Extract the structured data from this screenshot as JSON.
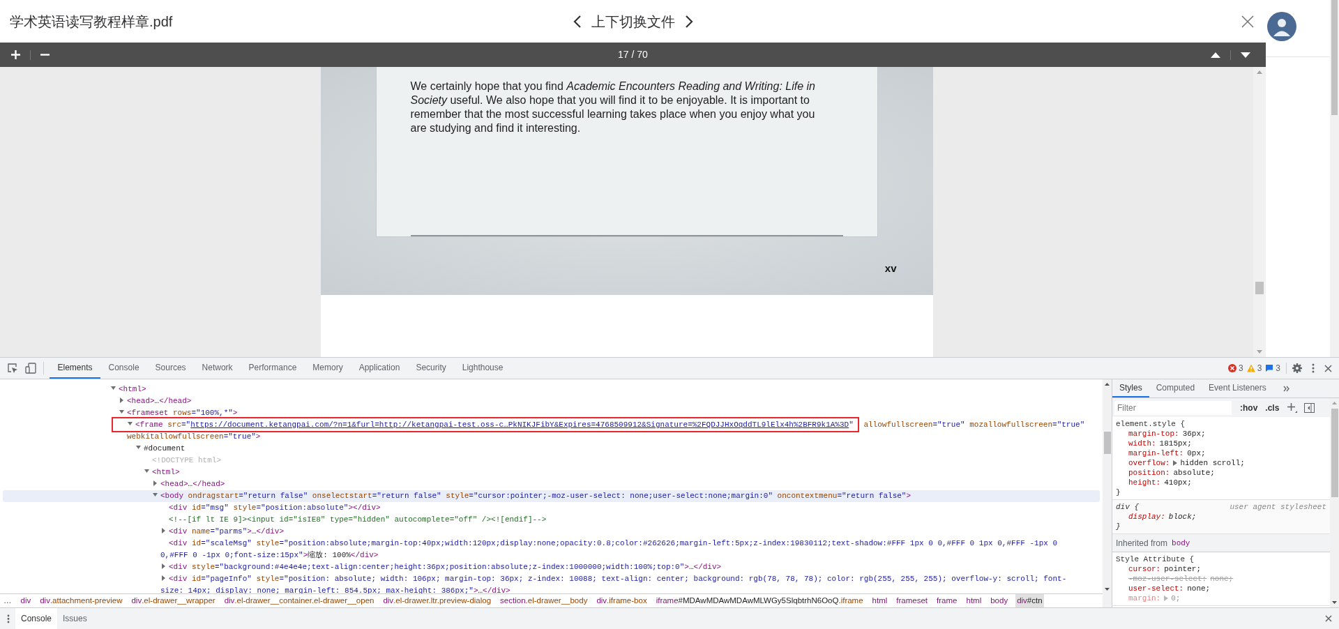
{
  "viewer": {
    "file_name": "学术英语读写教程样章.pdf",
    "switch_label": "上下切换文件",
    "page_indicator": "17 / 70"
  },
  "pdf_page": {
    "paragraph": "We certainly hope that you find *Academic Encounters Reading and Writing: Life in Society* useful. We also hope that you will find it to be enjoyable. It is important to remember that the most successful learning takes place when you enjoy what you are studying and find it interesting.",
    "folio": "xv"
  },
  "devtools": {
    "tabs": [
      {
        "label": "Elements",
        "selected": true
      },
      {
        "label": "Console",
        "selected": false
      },
      {
        "label": "Sources",
        "selected": false
      },
      {
        "label": "Network",
        "selected": false
      },
      {
        "label": "Performance",
        "selected": false
      },
      {
        "label": "Memory",
        "selected": false
      },
      {
        "label": "Application",
        "selected": false
      },
      {
        "label": "Security",
        "selected": false
      },
      {
        "label": "Lighthouse",
        "selected": false
      }
    ],
    "counters": [
      {
        "kind": "error",
        "count": "3"
      },
      {
        "kind": "warning",
        "count": "3"
      },
      {
        "kind": "info",
        "count": "3"
      }
    ],
    "dom_tree": [
      {
        "expanded": true,
        "selected": false,
        "parts": [
          {
            "kind": "tag",
            "text": "<html>"
          }
        ],
        "children": [
          {
            "expanded": false,
            "selected": false,
            "parts": [
              {
                "kind": "tag",
                "text": "<head>"
              },
              {
                "kind": "plain",
                "text": "…"
              },
              {
                "kind": "tag",
                "text": "</head>"
              }
            ]
          },
          {
            "expanded": true,
            "selected": false,
            "parts": [
              {
                "kind": "tag",
                "text": "<frameset"
              },
              {
                "kind": "attr",
                "text": " rows"
              },
              {
                "kind": "value",
                "text": "=\"100%,*\""
              },
              {
                "kind": "tag",
                "text": ">"
              }
            ],
            "children": [
              {
                "expanded": true,
                "selected": false,
                "highlight_parts": [
                  {
                    "kind": "tag",
                    "text": "<frame"
                  },
                  {
                    "kind": "attr",
                    "text": " src"
                  },
                  {
                    "kind": "value",
                    "text": "=\""
                  },
                  {
                    "kind": "link",
                    "text": "https://document.ketangpai.com/?n=1&furl=http://ketangpai-test.oss-c…PkNIKJFibY&Expires=4768509912&Signature=%2FQDJJHxOqddTL9lElx4h%2BFR9k1A%3D"
                  },
                  {
                    "kind": "value",
                    "text": "\""
                  }
                ],
                "parts": [
                  {
                    "kind": "attr",
                    "text": " allowfullscreen"
                  },
                  {
                    "kind": "value",
                    "text": "=\"true\""
                  },
                  {
                    "kind": "attr",
                    "text": " mozallowfullscreen"
                  },
                  {
                    "kind": "value",
                    "text": "=\"true\""
                  },
                  {
                    "kind": "attr",
                    "text": " webkitallowfullscreen"
                  },
                  {
                    "kind": "value",
                    "text": "=\"true\""
                  },
                  {
                    "kind": "tag",
                    "text": ">"
                  }
                ],
                "children": [
                  {
                    "expanded": true,
                    "selected": false,
                    "parts": [
                      {
                        "kind": "plain",
                        "text": "#document"
                      }
                    ],
                    "children": [
                      {
                        "selected": false,
                        "parts": [
                          {
                            "kind": "doctype",
                            "text": "<!DOCTYPE html>"
                          }
                        ]
                      },
                      {
                        "expanded": true,
                        "selected": false,
                        "parts": [
                          {
                            "kind": "tag",
                            "text": "<html>"
                          }
                        ],
                        "children": [
                          {
                            "expanded": false,
                            "selected": false,
                            "parts": [
                              {
                                "kind": "tag",
                                "text": "<head>"
                              },
                              {
                                "kind": "plain",
                                "text": "…"
                              },
                              {
                                "kind": "tag",
                                "text": "</head>"
                              }
                            ]
                          },
                          {
                            "expanded": true,
                            "selected": true,
                            "parts": [
                              {
                                "kind": "tag",
                                "text": "<body"
                              },
                              {
                                "kind": "attr",
                                "text": " ondragstart"
                              },
                              {
                                "kind": "value",
                                "text": "=\"return false\""
                              },
                              {
                                "kind": "attr",
                                "text": " onselectstart"
                              },
                              {
                                "kind": "value",
                                "text": "=\"return false\""
                              },
                              {
                                "kind": "attr",
                                "text": " style"
                              },
                              {
                                "kind": "value",
                                "text": "=\"cursor:pointer;-moz-user-select: none;user-select:none;margin:0\""
                              },
                              {
                                "kind": "attr",
                                "text": " oncontextmenu"
                              },
                              {
                                "kind": "value",
                                "text": "=\"return false\""
                              },
                              {
                                "kind": "tag",
                                "text": ">"
                              }
                            ],
                            "children": [
                              {
                                "selected": false,
                                "parts": [
                                  {
                                    "kind": "tag",
                                    "text": "<div"
                                  },
                                  {
                                    "kind": "attr",
                                    "text": " id"
                                  },
                                  {
                                    "kind": "value",
                                    "text": "=\"msg\""
                                  },
                                  {
                                    "kind": "attr",
                                    "text": " style"
                                  },
                                  {
                                    "kind": "value",
                                    "text": "=\"position:absolute\""
                                  },
                                  {
                                    "kind": "tag",
                                    "text": "></div>"
                                  }
                                ]
                              },
                              {
                                "selected": false,
                                "parts": [
                                  {
                                    "kind": "comment",
                                    "text": "<!--[if lt IE 9]><input id=\"isIE8\" type=\"hidden\" autocomplete=\"off\" /><![endif]-->"
                                  }
                                ]
                              },
                              {
                                "expanded": false,
                                "selected": false,
                                "parts": [
                                  {
                                    "kind": "tag",
                                    "text": "<div"
                                  },
                                  {
                                    "kind": "attr",
                                    "text": " name"
                                  },
                                  {
                                    "kind": "value",
                                    "text": "=\"parms\""
                                  },
                                  {
                                    "kind": "tag",
                                    "text": ">"
                                  },
                                  {
                                    "kind": "plain",
                                    "text": "…"
                                  },
                                  {
                                    "kind": "tag",
                                    "text": "</div>"
                                  }
                                ]
                              },
                              {
                                "selected": false,
                                "parts": [
                                  {
                                    "kind": "tag",
                                    "text": "<div"
                                  },
                                  {
                                    "kind": "attr",
                                    "text": " id"
                                  },
                                  {
                                    "kind": "value",
                                    "text": "=\"scaleMsg\""
                                  },
                                  {
                                    "kind": "attr",
                                    "text": " style"
                                  },
                                  {
                                    "kind": "value",
                                    "text": "=\"position:absolute;margin-top:40px;width:120px;display:none;opacity:0.8;color:#262626;margin-left:5px;z-index:19830112;text-shadow:#FFF 1px 0 0,#FFF 0 1px 0,#FFF -1px 0 0,#FFF 0 -1px 0;font-size:15px\""
                                  },
                                  {
                                    "kind": "tag",
                                    "text": ">"
                                  },
                                  {
                                    "kind": "plain",
                                    "text": "缩放: 100%"
                                  },
                                  {
                                    "kind": "tag",
                                    "text": "</div>"
                                  }
                                ]
                              },
                              {
                                "expanded": false,
                                "selected": false,
                                "parts": [
                                  {
                                    "kind": "tag",
                                    "text": "<div"
                                  },
                                  {
                                    "kind": "attr",
                                    "text": " style"
                                  },
                                  {
                                    "kind": "value",
                                    "text": "=\"background:#4e4e4e;text-align:center;height:36px;position:absolute;z-index:1000000;width:100%;top:0\""
                                  },
                                  {
                                    "kind": "tag",
                                    "text": ">"
                                  },
                                  {
                                    "kind": "plain",
                                    "text": "…"
                                  },
                                  {
                                    "kind": "tag",
                                    "text": "</div>"
                                  }
                                ]
                              },
                              {
                                "expanded": false,
                                "selected": false,
                                "parts": [
                                  {
                                    "kind": "tag",
                                    "text": "<div"
                                  },
                                  {
                                    "kind": "attr",
                                    "text": " id"
                                  },
                                  {
                                    "kind": "value",
                                    "text": "=\"pageInfo\""
                                  },
                                  {
                                    "kind": "attr",
                                    "text": " style"
                                  },
                                  {
                                    "kind": "value",
                                    "text": "=\"position: absolute; width: 106px; margin-top: 36px; z-index: 10088; text-align: center; background: rgb(78, 78, 78); color: rgb(255, 255, 255); overflow-y: scroll; font-size: 14px; display: none; margin-left: 854.5px; max-height: 386px;\""
                                  },
                                  {
                                    "kind": "tag",
                                    "text": ">"
                                  },
                                  {
                                    "kind": "plain",
                                    "text": "…"
                                  },
                                  {
                                    "kind": "tag",
                                    "text": "</div>"
                                  }
                                ]
                              }
                            ]
                          }
                        ]
                      }
                    ]
                  }
                ]
              }
            ]
          }
        ]
      }
    ],
    "breadcrumb_overflow": "…",
    "breadcrumbs": [
      {
        "tag": "div",
        "selected": false
      },
      {
        "tag": "div",
        "classes": ".attachment-preview",
        "selected": false
      },
      {
        "tag": "div",
        "classes": ".el-drawer__wrapper",
        "selected": false
      },
      {
        "tag": "div",
        "classes": ".el-drawer__container.el-drawer__open",
        "selected": false
      },
      {
        "tag": "div",
        "classes": ".el-drawer.ltr.preview-dialog",
        "selected": false
      },
      {
        "tag": "section",
        "classes": ".el-drawer__body",
        "selected": false
      },
      {
        "tag": "div",
        "classes": ".iframe-box",
        "selected": false
      },
      {
        "tag": "iframe",
        "id": "#MDAwMDAwMDAwMLWGy5SlqbtrhN6OoQ",
        "classes": ".iframe",
        "selected": false
      },
      {
        "tag": "html",
        "selected": false
      },
      {
        "tag": "frameset",
        "selected": false
      },
      {
        "tag": "frame",
        "selected": false
      },
      {
        "tag": "html",
        "selected": false
      },
      {
        "tag": "body",
        "selected": false
      },
      {
        "tag": "div",
        "id": "#ctn",
        "selected": true
      }
    ],
    "styles_panel": {
      "tabs": [
        {
          "label": "Styles",
          "selected": true
        },
        {
          "label": "Computed",
          "selected": false
        },
        {
          "label": "Event Listeners",
          "selected": false
        }
      ],
      "filter": {
        "placeholder": "Filter"
      },
      "toggles": [
        ":hov",
        ".cls"
      ],
      "rules": [
        {
          "kind": "rule",
          "selector": "element.style {",
          "close": "}",
          "properties": [
            {
              "name": "margin-top:",
              "value": "36px;",
              "overridden": false,
              "inactive": false,
              "expandable": false
            },
            {
              "name": "width:",
              "value": "1815px;",
              "overridden": false,
              "inactive": false,
              "expandable": false
            },
            {
              "name": "margin-left:",
              "value": "0px;",
              "overridden": false,
              "inactive": false,
              "expandable": false
            },
            {
              "name": "overflow:",
              "value": "hidden scroll;",
              "overridden": false,
              "inactive": false,
              "expandable": true
            },
            {
              "name": "position:",
              "value": "absolute;",
              "overridden": false,
              "inactive": false,
              "expandable": false
            },
            {
              "name": "height:",
              "value": "410px;",
              "overridden": false,
              "inactive": false,
              "expandable": false
            }
          ]
        },
        {
          "kind": "rule",
          "selector": "div {",
          "origin": "user agent stylesheet",
          "close": "}",
          "properties": [
            {
              "name": "display:",
              "value": "block;",
              "overridden": false,
              "inactive": false,
              "expandable": false
            }
          ]
        },
        {
          "kind": "inherited",
          "label": "Inherited from",
          "source": "body"
        },
        {
          "kind": "rule",
          "selector": "Style Attribute {",
          "properties": [
            {
              "name": "cursor:",
              "value": "pointer;",
              "overridden": false,
              "inactive": false,
              "expandable": false
            },
            {
              "name": "-moz-user-select:",
              "value": "none;",
              "overridden": true,
              "inactive": false,
              "expandable": false
            },
            {
              "name": "user-select:",
              "value": "none;",
              "overridden": false,
              "inactive": false,
              "expandable": false
            },
            {
              "name": "margin:",
              "value": "0;",
              "overridden": false,
              "inactive": true,
              "expandable": true
            }
          ]
        }
      ]
    },
    "drawer": {
      "tabs": [
        {
          "label": "Console",
          "selected": true
        },
        {
          "label": "Issues",
          "selected": false
        }
      ]
    }
  }
}
